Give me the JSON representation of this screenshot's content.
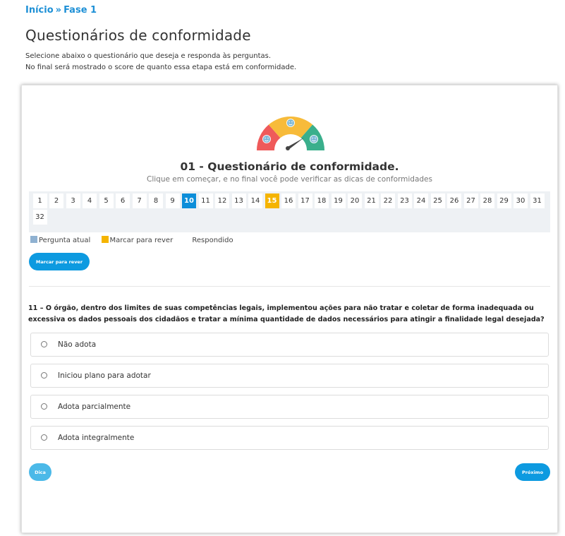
{
  "breadcrumb": {
    "home": "Início",
    "separator": "»",
    "current": "Fase 1"
  },
  "page": {
    "title": "Questionários de conformidade",
    "intro_line1": "Selecione abaixo o questionário que deseja e responda às perguntas.",
    "intro_line2": "No final será mostrado o score de quanto essa etapa está em conformidade."
  },
  "quiz": {
    "title": "01 - Questionário de conformidade.",
    "subtitle": "Clique em começar, e no final você pode verificar as dicas de conformidades"
  },
  "question_numbers": [
    "1",
    "2",
    "3",
    "4",
    "5",
    "6",
    "7",
    "8",
    "9",
    "10",
    "11",
    "12",
    "13",
    "14",
    "15",
    "16",
    "17",
    "18",
    "19",
    "20",
    "21",
    "22",
    "23",
    "24",
    "25",
    "26",
    "27",
    "28",
    "29",
    "30",
    "31",
    "32"
  ],
  "current_question": "10",
  "review_question": "15",
  "legend": {
    "current": "Pergunta atual",
    "review": "Marcar para rever",
    "answered": "Respondido"
  },
  "buttons": {
    "mark_review": "Marcar para rever",
    "tip": "Dica",
    "next": "Próximo"
  },
  "question": {
    "text": "11 – O órgão, dentro dos limites de suas competências legais, implementou ações para não tratar e coletar de forma inadequada ou excessiva os dados pessoais dos cidadãos e tratar a mínima quantidade  de dados necessários para atingir a finalidade legal desejada?",
    "options": [
      "Não adota",
      "Iniciou plano para adotar",
      "Adota parcialmente",
      "Adota integralmente"
    ]
  },
  "colors": {
    "link": "#1e90d6",
    "current": "#0d8ed9",
    "review": "#f5b400",
    "gauge_red": "#ef5a5a",
    "gauge_yellow": "#f7bb3a",
    "gauge_green": "#3aaf8c"
  }
}
